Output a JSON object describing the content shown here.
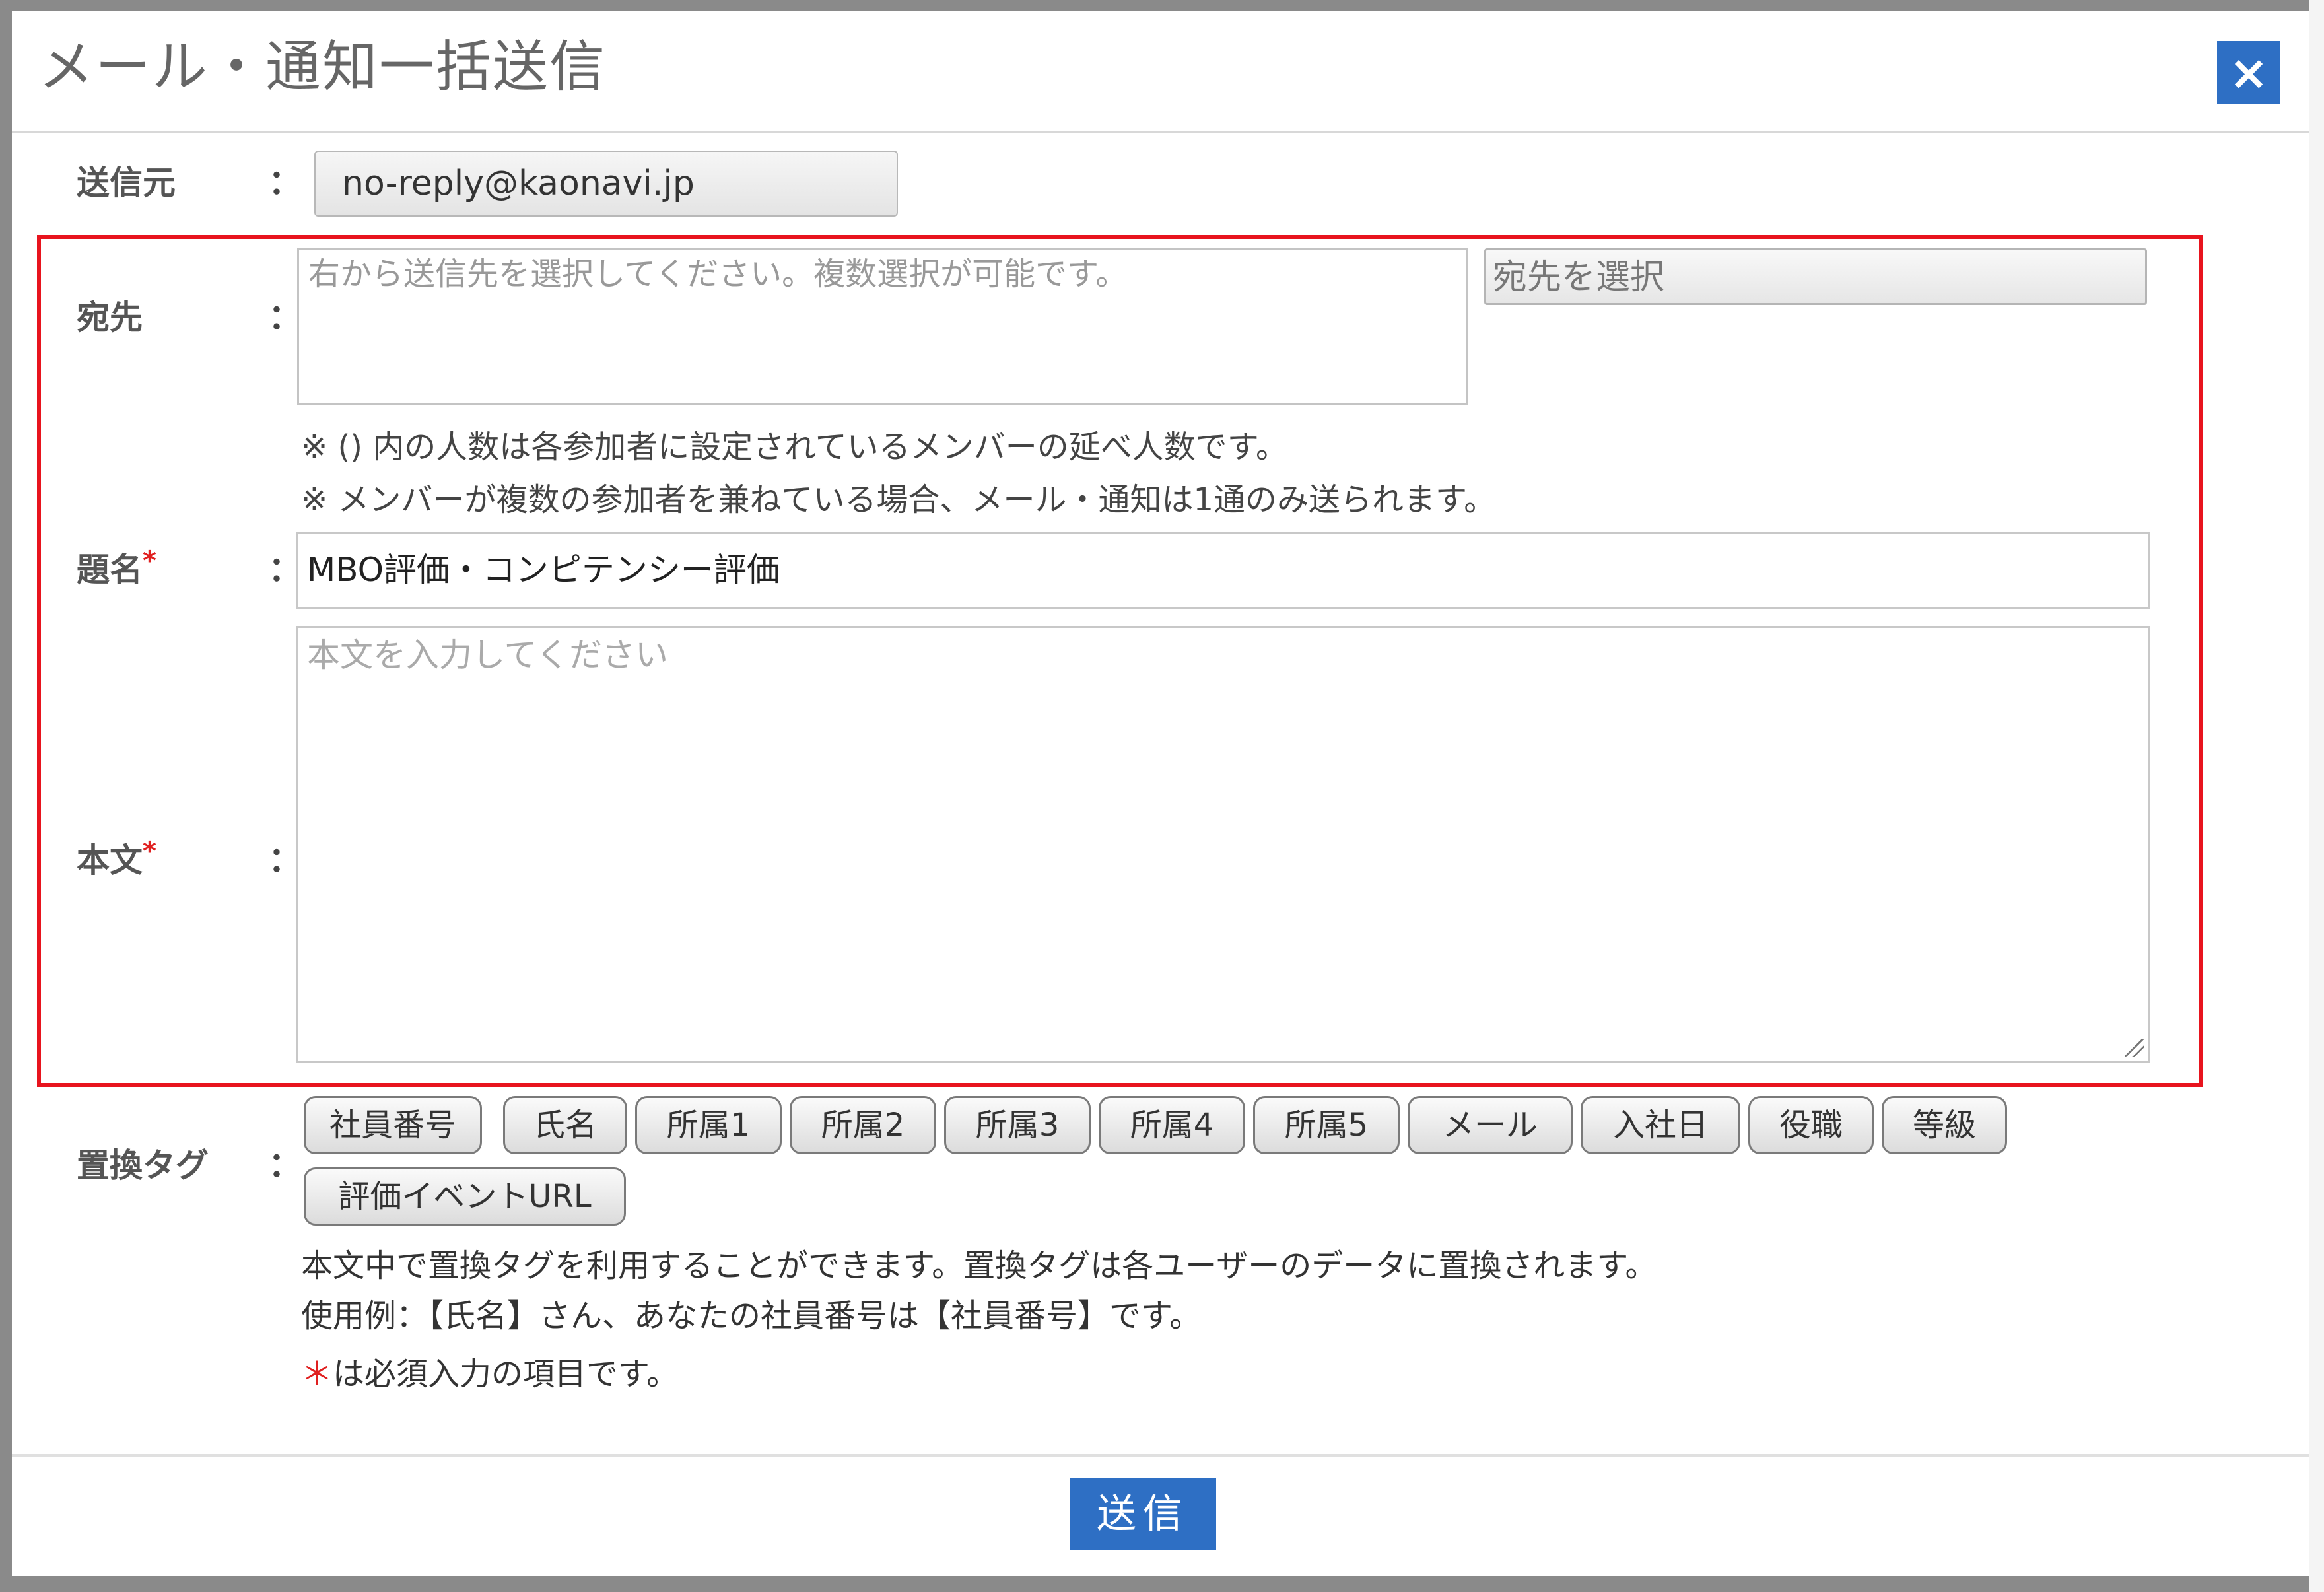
{
  "dialog": {
    "title": "メール・通知一括送信",
    "close_label": "×"
  },
  "form": {
    "sender": {
      "label": "送信元",
      "value": "no-reply@kaonavi.jp"
    },
    "recipients": {
      "label": "宛先",
      "placeholder": "右から送信先を選択してください。複数選択が可能です。",
      "select_label": "宛先を選択",
      "notes": [
        "※ () 内の人数は各参加者に設定されているメンバーの延べ人数です。",
        "※ メンバーが複数の参加者を兼ねている場合、メール・通知は1通のみ送られます。"
      ]
    },
    "subject": {
      "label": "題名",
      "required_mark": "*",
      "value": "MBO評価・コンピテンシー評価"
    },
    "body": {
      "label": "本文",
      "required_mark": "*",
      "placeholder": "本文を入力してください"
    },
    "colon": "："
  },
  "replace_tags": {
    "label": "置換タグ",
    "tags": [
      "社員番号",
      "氏名",
      "所属1",
      "所属2",
      "所属3",
      "所属4",
      "所属5",
      "メール",
      "入社日",
      "役職",
      "等級",
      "評価イベントURL"
    ],
    "info": [
      "本文中で置換タグを利用することができます。置換タグは各ユーザーのデータに置換されます。",
      "使用例：【氏名】さん、あなたの社員番号は【社員番号】です。"
    ],
    "required_note_mark": "＊",
    "required_note": "は必須入力の項目です。"
  },
  "footer": {
    "send_label": "送信"
  },
  "colors": {
    "accent": "#2e6fc4",
    "highlight_frame": "#e8141e",
    "required": "#e02020"
  }
}
